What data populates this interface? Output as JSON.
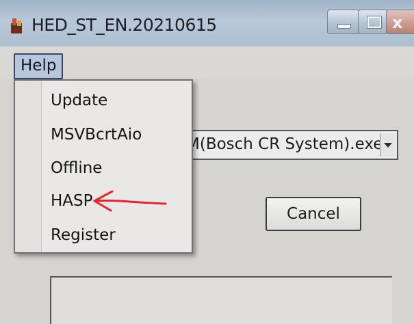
{
  "window": {
    "title": "HED_ST_EN.20210615",
    "controls": {
      "minimize": "minimize-icon",
      "maximize": "maximize-icon",
      "close": "close-icon"
    }
  },
  "menubar": {
    "items": [
      {
        "label": "Help",
        "state": "open"
      }
    ]
  },
  "dropdown": {
    "items": [
      {
        "label": "Update"
      },
      {
        "label": "MSVBcrtAio"
      },
      {
        "label": "Offline"
      },
      {
        "label": "HASP"
      },
      {
        "label": "Register"
      }
    ],
    "annotated_item": "HASP"
  },
  "dialog": {
    "combo_value": "M(Bosch CR System).exe",
    "cancel_label": "Cancel"
  },
  "colors": {
    "annotation_arrow": "#e8232a",
    "titlebar": "#a9bccf",
    "background": "#d6d4d1"
  }
}
